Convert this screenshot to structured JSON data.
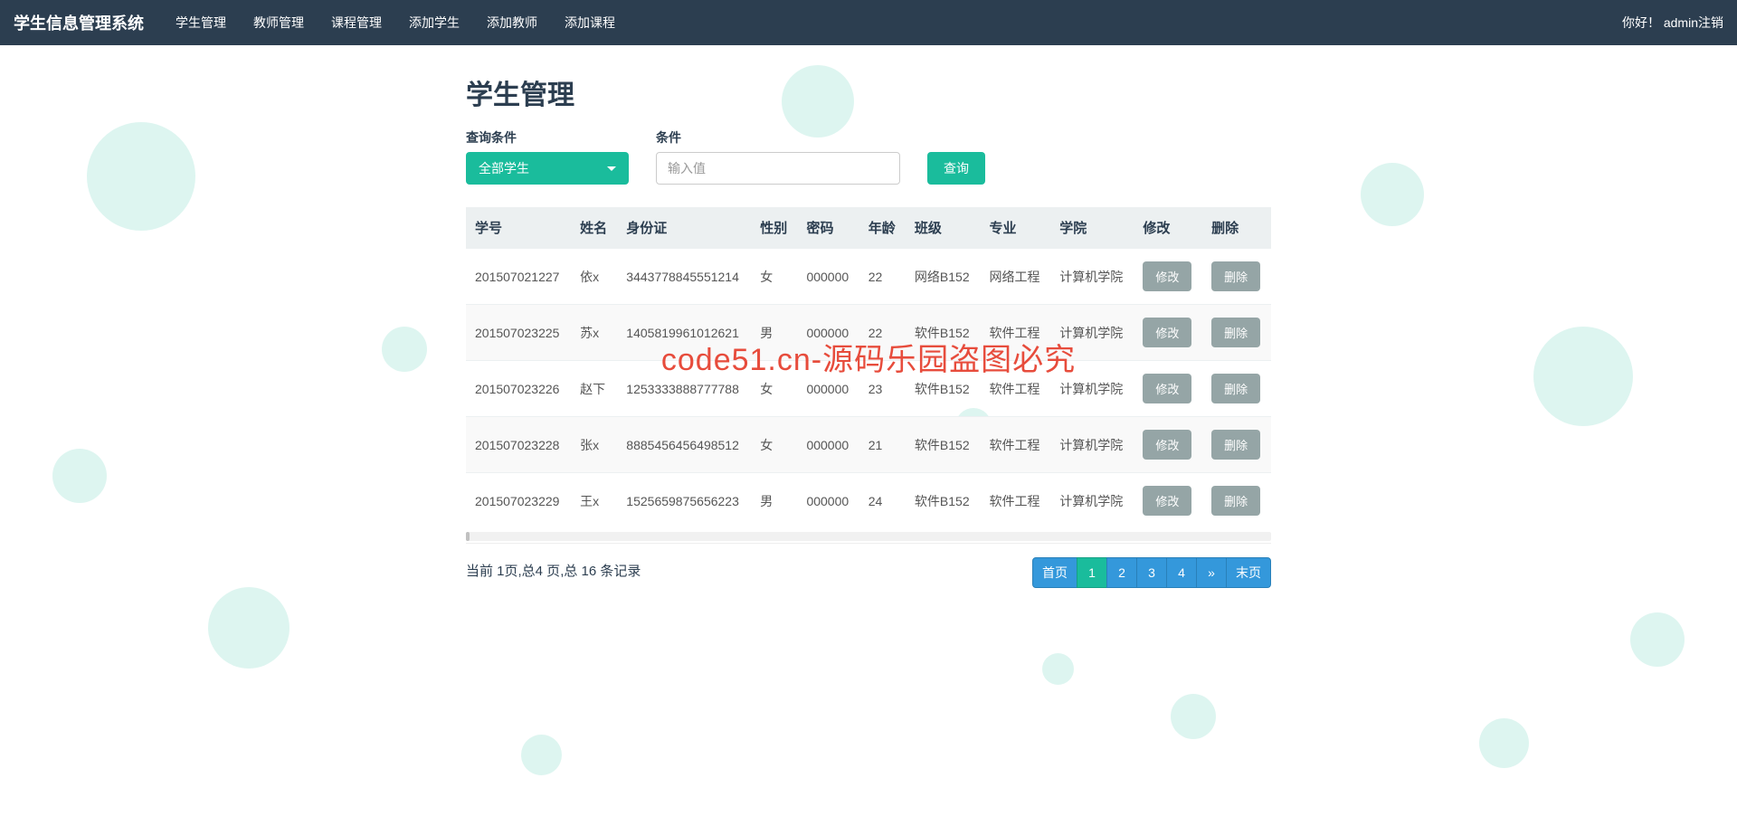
{
  "navbar": {
    "brand": "学生信息管理系统",
    "items": [
      "学生管理",
      "教师管理",
      "课程管理",
      "添加学生",
      "添加教师",
      "添加课程"
    ],
    "greeting": "你好！",
    "user": "admin",
    "logout": "注销"
  },
  "page": {
    "title": "学生管理",
    "query_label": "查询条件",
    "cond_label": "条件",
    "select_value": "全部学生",
    "input_placeholder": "输入值",
    "query_btn": "查询"
  },
  "table": {
    "headers": [
      "学号",
      "姓名",
      "身份证",
      "性别",
      "密码",
      "年龄",
      "班级",
      "专业",
      "学院",
      "修改",
      "删除"
    ],
    "edit_label": "修改",
    "delete_label": "删除",
    "rows": [
      {
        "id": "201507021227",
        "name": "依x",
        "idcard": "3443778845551214",
        "gender": "女",
        "pwd": "000000",
        "age": "22",
        "class": "网络B152",
        "major": "网络工程",
        "college": "计算机学院"
      },
      {
        "id": "201507023225",
        "name": "苏x",
        "idcard": "1405819961012621",
        "gender": "男",
        "pwd": "000000",
        "age": "22",
        "class": "软件B152",
        "major": "软件工程",
        "college": "计算机学院"
      },
      {
        "id": "201507023226",
        "name": "赵下",
        "idcard": "1253333888777788",
        "gender": "女",
        "pwd": "000000",
        "age": "23",
        "class": "软件B152",
        "major": "软件工程",
        "college": "计算机学院"
      },
      {
        "id": "201507023228",
        "name": "张x",
        "idcard": "8885456456498512",
        "gender": "女",
        "pwd": "000000",
        "age": "21",
        "class": "软件B152",
        "major": "软件工程",
        "college": "计算机学院"
      },
      {
        "id": "201507023229",
        "name": "王x",
        "idcard": "1525659875656223",
        "gender": "男",
        "pwd": "000000",
        "age": "24",
        "class": "软件B152",
        "major": "软件工程",
        "college": "计算机学院"
      }
    ]
  },
  "pagination": {
    "info": "当前 1页,总4 页,总 16 条记录",
    "first": "首页",
    "pages": [
      "1",
      "2",
      "3",
      "4"
    ],
    "next": "»",
    "last": "末页",
    "active": "1"
  },
  "watermark": "code51.cn-源码乐园盗图必究"
}
